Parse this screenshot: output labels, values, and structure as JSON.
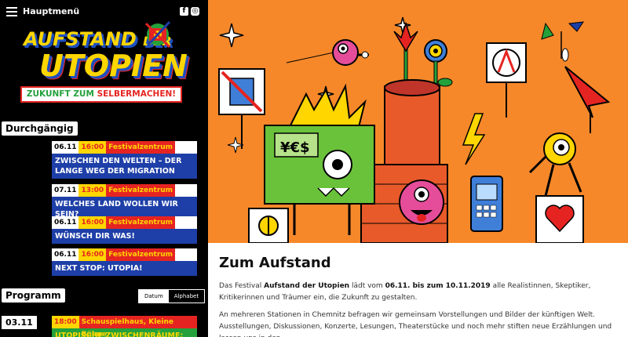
{
  "header": {
    "menu_label": "Hauptmenü",
    "facebook": "f",
    "instagram": "◎"
  },
  "logo": {
    "line1_a": "AUFSTAND ",
    "line1_b": "DER",
    "line2": "UTOPIEN",
    "tagline_a": "ZUKUNFT ",
    "tagline_b": "ZUM ",
    "tagline_c": "SELBERMACHEN!"
  },
  "sidebar": {
    "section1": "Durchgängig",
    "events": [
      {
        "date": "06.11",
        "time": "16:00",
        "place": "Festivalzentrum",
        "title": "ZWISCHEN DEN WELTEN – DER LANGE WEG DER MIGRATION"
      },
      {
        "date": "07.11",
        "time": "13:00",
        "place": "Festivalzentrum",
        "title": "WELCHES LAND WOLLEN WIR SEIN?"
      },
      {
        "date": "06.11",
        "time": "16:00",
        "place": "Festivalzentrum",
        "title": "WÜNSCH DIR WAS!"
      },
      {
        "date": "06.11",
        "time": "16:00",
        "place": "Festivalzentrum",
        "title": "NEXT STOP: UTOPIA!"
      }
    ],
    "section2": "Programm",
    "sort": {
      "a": "Datum",
      "b": "Alphabet"
    },
    "day": "03.11",
    "next_event": {
      "time": "18:00",
      "place": "Schauspielhaus, Kleine Bühne",
      "title": "UTOPISCHE ZWISCHENRÄUME: UMBRÜCHE"
    }
  },
  "hero": {
    "sign_text": "¥€$"
  },
  "article": {
    "title": "Zum Aufstand",
    "p1": {
      "t1": "Das Festival ",
      "b1": "Aufstand der Utopien",
      "t2": " lädt vom ",
      "b2": "06.11. bis zum 10.11.2019",
      "t3": " alle Realistinnen, Skeptiker, Kritikerinnen und Träumer ein, die Zukunft zu gestalten."
    },
    "p2": "An mehreren Stationen in Chemnitz befragen wir gemeinsam Vorstellungen und Bilder der künftigen Welt. Ausstellungen, Diskussionen, Konzerte, Lesungen, Theaterstücke und noch mehr stiften neue Erzählungen und lassen uns in den"
  },
  "colors": {
    "yellow": "#ffd600",
    "red": "#e52421",
    "blue": "#1e3fa8",
    "green": "#24a13b",
    "orange": "#f6882a"
  }
}
